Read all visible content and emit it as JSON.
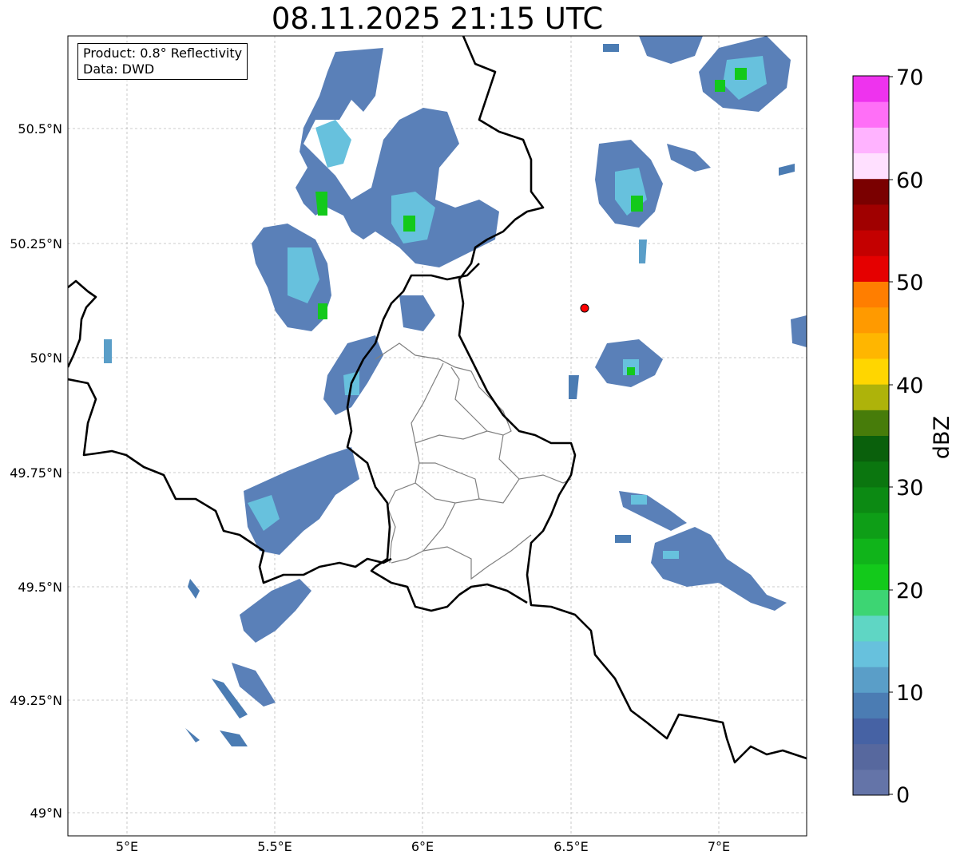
{
  "title": "08.11.2025 21:15 UTC",
  "info": {
    "product": "Product: 0.8° Reflectivity",
    "data": "Data: DWD"
  },
  "axes": {
    "lon_ticks": [
      "5°E",
      "5.5°E",
      "6°E",
      "6.5°E",
      "7°E"
    ],
    "lat_ticks": [
      "50.5°N",
      "50.25°N",
      "50°N",
      "49.75°N",
      "49.5°N",
      "49.25°N",
      "49°N"
    ]
  },
  "colorbar": {
    "unit": "dBZ",
    "tick_labels": [
      "70",
      "60",
      "50",
      "40",
      "30",
      "20",
      "10",
      "0"
    ],
    "colors": [
      "#6474a8",
      "#57689e",
      "#4662a4",
      "#4b7cb3",
      "#5a9ec8",
      "#67c1dd",
      "#5fd6c4",
      "#3dd573",
      "#13c91b",
      "#10b41a",
      "#0e9e17",
      "#0c8a13",
      "#0b760f",
      "#0a600c",
      "#477c0a",
      "#aeb30a",
      "#ffd600",
      "#ffb600",
      "#ff9a00",
      "#ff7e00",
      "#e50000",
      "#c40000",
      "#a00000",
      "#7a0000",
      "#ffe0ff",
      "#ffb3ff",
      "#ff6ff7",
      "#ee33ee"
    ]
  },
  "site_marker": {
    "name": "radar-site",
    "color": "#ff0000"
  }
}
